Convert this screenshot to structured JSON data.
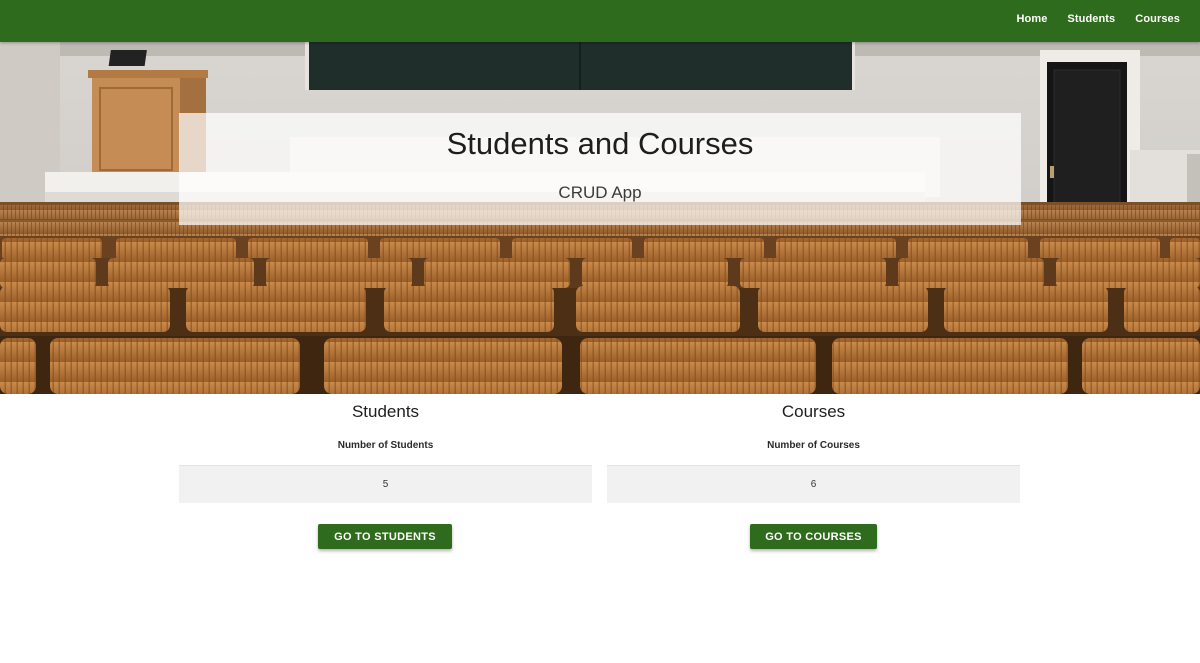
{
  "nav": {
    "links": [
      {
        "label": "Home"
      },
      {
        "label": "Students"
      },
      {
        "label": "Courses"
      }
    ]
  },
  "hero": {
    "title": "Students and Courses",
    "subtitle": "CRUD App",
    "image": "lecture-hall-wooden-seats-photo"
  },
  "students_card": {
    "heading": "Students",
    "label": "Number of Students",
    "value": "5",
    "button_label": "GO TO STUDENTS"
  },
  "courses_card": {
    "heading": "Courses",
    "label": "Number of Courses",
    "value": "6",
    "button_label": "GO TO COURSES"
  },
  "colors": {
    "brand_green": "#2f6b1c",
    "value_box_bg": "#f1f1f1"
  }
}
